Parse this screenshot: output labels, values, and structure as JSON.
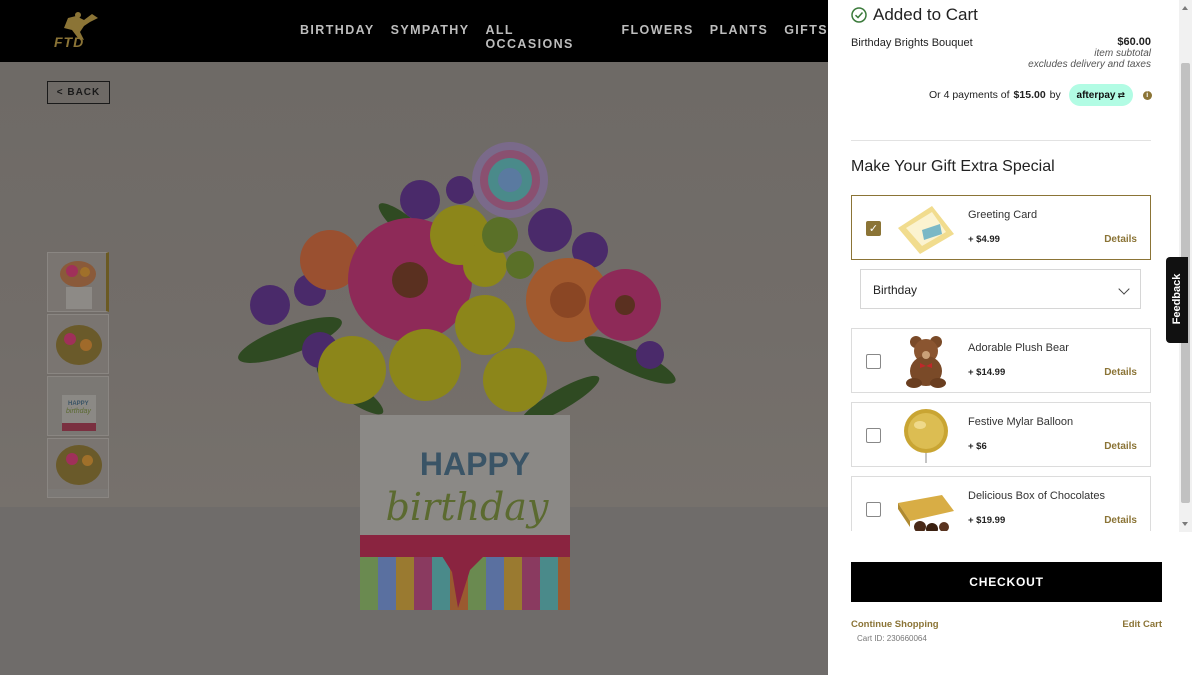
{
  "brand": {
    "logo_text": "FTD"
  },
  "nav": {
    "links": [
      "BIRTHDAY",
      "SYMPATHY",
      "ALL OCCASIONS",
      "FLOWERS",
      "PLANTS",
      "GIFTS"
    ]
  },
  "product_page": {
    "back_label": "< BACK",
    "vase_text_1": "HAPPY",
    "vase_text_2": "birthday",
    "thumb_text_1": "HAPPY",
    "thumb_text_2": "birthday"
  },
  "cart": {
    "added_title": "Added to Cart",
    "item_name": "Birthday Brights Bouquet",
    "item_price": "$60.00",
    "subtotal_label": "item subtotal",
    "excludes_label": "excludes delivery and taxes",
    "afterpay": {
      "prefix": "Or 4 payments of",
      "amount": "$15.00",
      "suffix": "by",
      "badge": "afterpay"
    },
    "special_title": "Make Your Gift Extra Special",
    "addons": [
      {
        "name": "Greeting Card",
        "price": "+ $4.99",
        "details": "Details",
        "checked": true
      },
      {
        "name": "Adorable Plush Bear",
        "price": "+ $14.99",
        "details": "Details",
        "checked": false
      },
      {
        "name": "Festive Mylar Balloon",
        "price": "+ $6",
        "details": "Details",
        "checked": false
      },
      {
        "name": "Delicious Box of Chocolates",
        "price": "+ $19.99",
        "details": "Details",
        "checked": false
      }
    ],
    "card_occasion": "Birthday",
    "checkout_label": "CHECKOUT",
    "continue_label": "Continue Shopping",
    "edit_label": "Edit Cart",
    "cart_id": "Cart ID: 230660064",
    "feedback_label": "Feedback"
  },
  "colors": {
    "accent": "#8b7436",
    "afterpay": "#b2fce4",
    "overlay": "rgba(0,0,0,0.55)"
  }
}
